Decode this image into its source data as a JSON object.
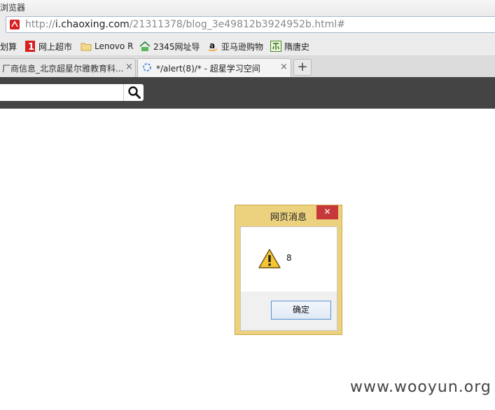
{
  "window": {
    "title": "浏览器"
  },
  "address_bar": {
    "url_prefix": "http://",
    "url_host": "i.chaoxing.com",
    "url_path": "/21311378/blog_3e49812b3924952b.html#"
  },
  "bookmarks": [
    {
      "label": "划算",
      "icon": "partial-icon"
    },
    {
      "label": "网上超市",
      "icon": "red-1-icon"
    },
    {
      "label": "Lenovo R",
      "icon": "folder-icon"
    },
    {
      "label": "2345网址导",
      "icon": "house-icon"
    },
    {
      "label": "亚马逊购物",
      "icon": "amazon-a-icon"
    },
    {
      "label": "隋唐史",
      "icon": "green-glyph-icon"
    }
  ],
  "tabs": [
    {
      "label": "厂商信息_北京超星尔雅教育科...",
      "active": false,
      "close": "×"
    },
    {
      "label": "*/alert(8)/* - 超星学习空间",
      "active": true,
      "close": "×"
    }
  ],
  "new_tab_label": "+",
  "site_search": {
    "placeholder": ""
  },
  "dialog": {
    "title": "网页消息",
    "close": "✕",
    "message": "8",
    "ok_label": "确定"
  },
  "watermark": "www.wooyun.org",
  "colors": {
    "site_header": "#444444",
    "dialog_frame": "#ecd27e",
    "dialog_close": "#c7383a",
    "favicon": "#d6201f"
  }
}
